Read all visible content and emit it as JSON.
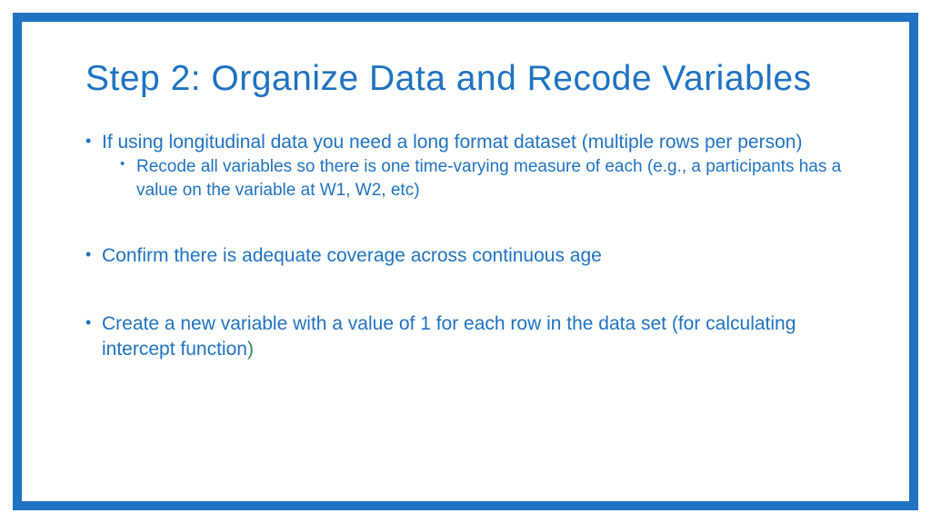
{
  "slide": {
    "title": "Step 2: Organize Data and Recode Variables",
    "bullets": [
      {
        "text": "If using longitudinal data you need a long format dataset (multiple rows per person)",
        "sub": [
          "Recode all variables so there is one time-varying measure of each (e.g., a participants has a value on the variable at W1, W2, etc)"
        ]
      },
      {
        "text": "Confirm there is adequate coverage across continuous age"
      },
      {
        "text_before_paren": "Create a new variable with a value of 1 for each row in the data set (for calculating intercept function",
        "close_paren": ")"
      }
    ]
  }
}
